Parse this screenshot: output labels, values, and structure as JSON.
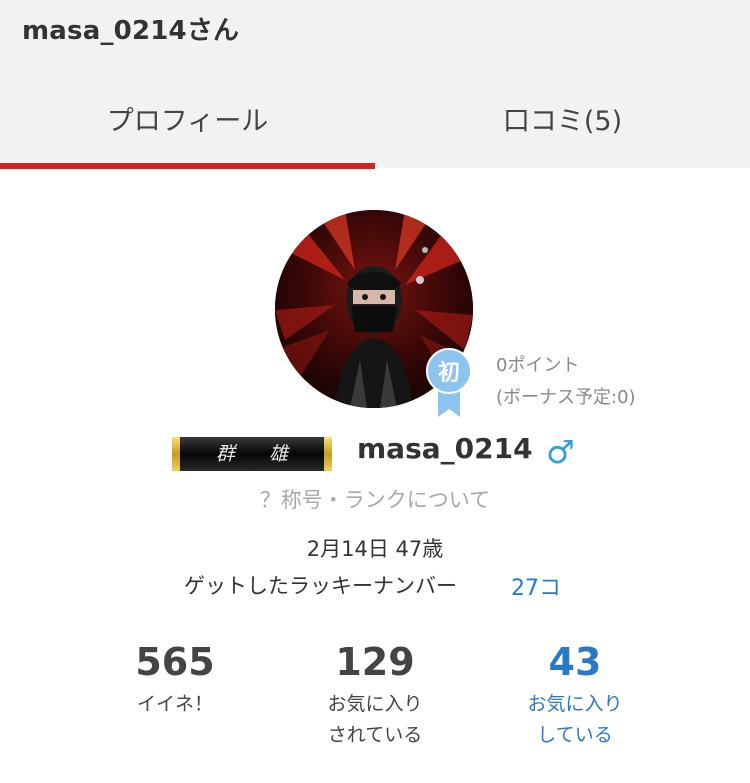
{
  "header": {
    "title": "masa_0214さん"
  },
  "tabs": [
    {
      "label": "プロフィール",
      "active": true
    },
    {
      "label": "口コミ(5)",
      "active": false
    }
  ],
  "badge": {
    "label": "初"
  },
  "points": {
    "value": "0ポイント",
    "bonus": "(ボーナス予定:0)"
  },
  "rank": {
    "title": "群 雄"
  },
  "profile": {
    "username": "masa_0214",
    "gender_symbol": "♂",
    "birthday_age": "2月14日 47歳"
  },
  "rank_link": "？称号・ランクについて",
  "lucky": {
    "label": "ゲットしたラッキーナンバー",
    "count": "27コ"
  },
  "stats": [
    {
      "value": "565",
      "label_line1": "イイネ！",
      "label_line2": ""
    },
    {
      "value": "129",
      "label_line1": "お気に入り",
      "label_line2": "されている"
    },
    {
      "value": "43",
      "label_line1": "お気に入り",
      "label_line2": "している"
    }
  ],
  "colors": {
    "accent_red": "#d0241d",
    "link_blue": "#2a78c8",
    "gender_blue": "#2f9fd8",
    "badge_blue": "#8cc4ef"
  }
}
